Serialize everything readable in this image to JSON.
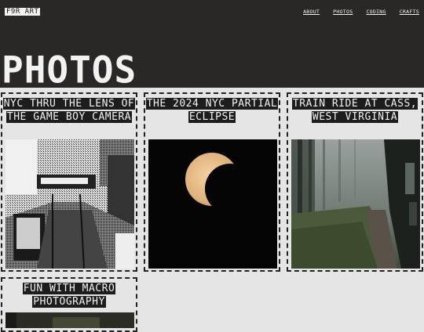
{
  "site": {
    "logo": "F9R ART"
  },
  "nav": {
    "items": [
      "ABOUT",
      "PHOTOS",
      "CODING",
      "CRAFTS"
    ]
  },
  "page": {
    "title": "PHOTOS"
  },
  "cards": [
    {
      "title": "NYC THRU THE LENS OF THE GAME BOY CAMERA"
    },
    {
      "title": "THE 2024 NYC PARTIAL ECLIPSE"
    },
    {
      "title": "TRAIN RIDE AT CASS, WEST VIRGINIA"
    },
    {
      "title": "FUN WITH MACRO PHOTOGRAPHY"
    }
  ],
  "colors": {
    "header_bg": "#2a2727",
    "page_bg": "#e5e5e5",
    "text_light": "#f2f2f2"
  }
}
